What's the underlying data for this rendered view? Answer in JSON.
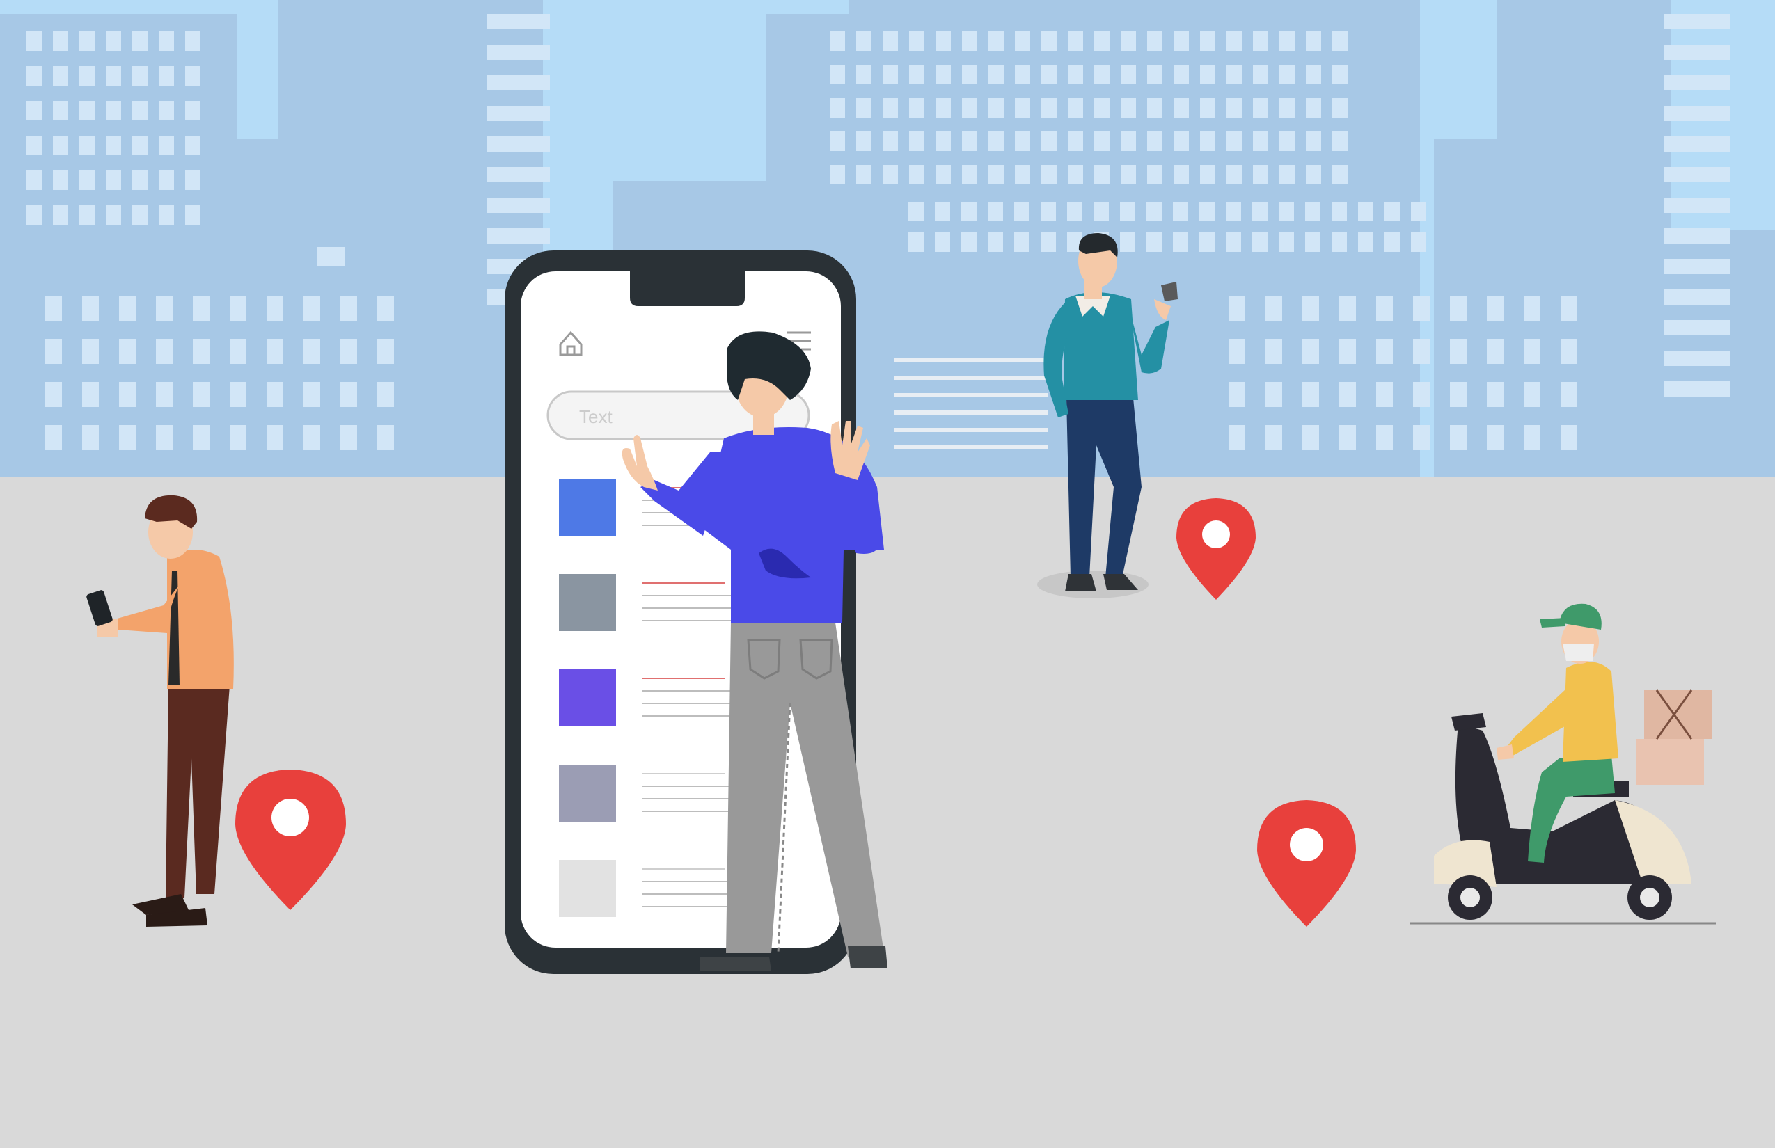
{
  "phone": {
    "search": {
      "placeholder": "Text"
    },
    "list_items": [
      {
        "swatch_color": "#4e79e6"
      },
      {
        "swatch_color": "#8a95a1"
      },
      {
        "swatch_color": "#6a4fe6"
      },
      {
        "swatch_color": "#9b9db4"
      },
      {
        "swatch_color": "#e2e2e2"
      }
    ],
    "icons": {
      "home": "home-icon"
    }
  },
  "colors": {
    "sky": "#b5dcf7",
    "buildings": "#a7c8e6",
    "windows": "#d2e6f7",
    "ground": "#d9d9d9",
    "pin": "#e8403c",
    "phone_frame": "#2a3136",
    "screen": "#ffffff"
  },
  "map_pins": [
    {
      "name": "pin-left"
    },
    {
      "name": "pin-center"
    },
    {
      "name": "pin-right"
    }
  ]
}
